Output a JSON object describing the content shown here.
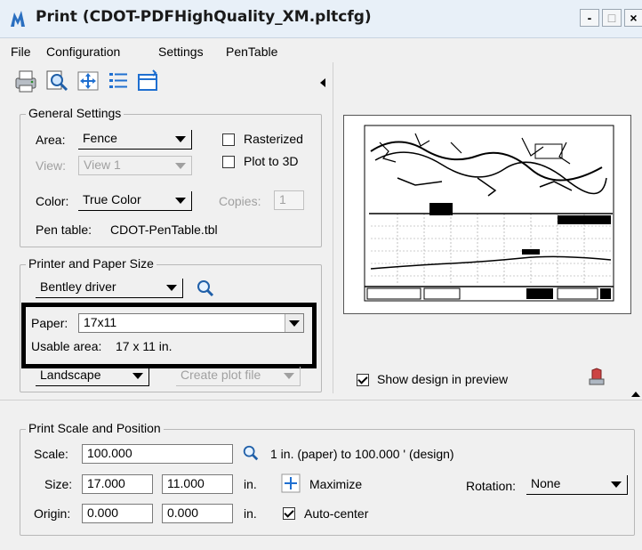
{
  "window": {
    "title": "Print  (CDOT-PDFHighQuality_XM.pltcfg)",
    "minimize_glyph": "-",
    "maximize_glyph": "□",
    "close_glyph": "×"
  },
  "menu": [
    "File",
    "Configuration",
    "Settings",
    "PenTable"
  ],
  "toolbar": {
    "icons": [
      "printer-icon",
      "preview-zoom-icon",
      "fit-move-icon",
      "list-icon",
      "window-icon"
    ]
  },
  "general_settings": {
    "title": "General Settings",
    "area_label": "Area:",
    "area_value": "Fence",
    "view_label": "View:",
    "view_value": "View 1",
    "color_label": "Color:",
    "color_value": "True Color",
    "copies_label": "Copies:",
    "copies_value": "1",
    "rasterized_label": "Rasterized",
    "rasterized_checked": false,
    "plot3d_label": "Plot to 3D",
    "plot3d_checked": false,
    "pen_table_label": "Pen table:",
    "pen_table_value": "CDOT-PenTable.tbl"
  },
  "printer_paper": {
    "title": "Printer and Paper Size",
    "driver_value": "Bentley driver",
    "paper_label": "Paper:",
    "paper_value": "17x11",
    "usable_area_label": "Usable area:",
    "usable_area_value": "17 x 11 in.",
    "orientation_value": "Landscape",
    "plot_target_value": "Create plot file"
  },
  "preview": {
    "show_design_label": "Show design in preview",
    "show_design_checked": true
  },
  "scale_position": {
    "title": "Print Scale and Position",
    "scale_label": "Scale:",
    "scale_value": "100.000",
    "scale_desc": "1 in. (paper) to 100.000 ' (design)",
    "size_label": "Size:",
    "size_w": "17.000",
    "size_h": "11.000",
    "size_unit": "in.",
    "maximize_label": "Maximize",
    "rotation_label": "Rotation:",
    "rotation_value": "None",
    "origin_label": "Origin:",
    "origin_x": "0.000",
    "origin_y": "0.000",
    "origin_unit": "in.",
    "autocenter_label": "Auto-center",
    "autocenter_checked": true
  },
  "colors": {
    "highlight_box": "#000000",
    "title_bar": "#e8f0f8",
    "dialog_bg": "#f0f0f0"
  }
}
